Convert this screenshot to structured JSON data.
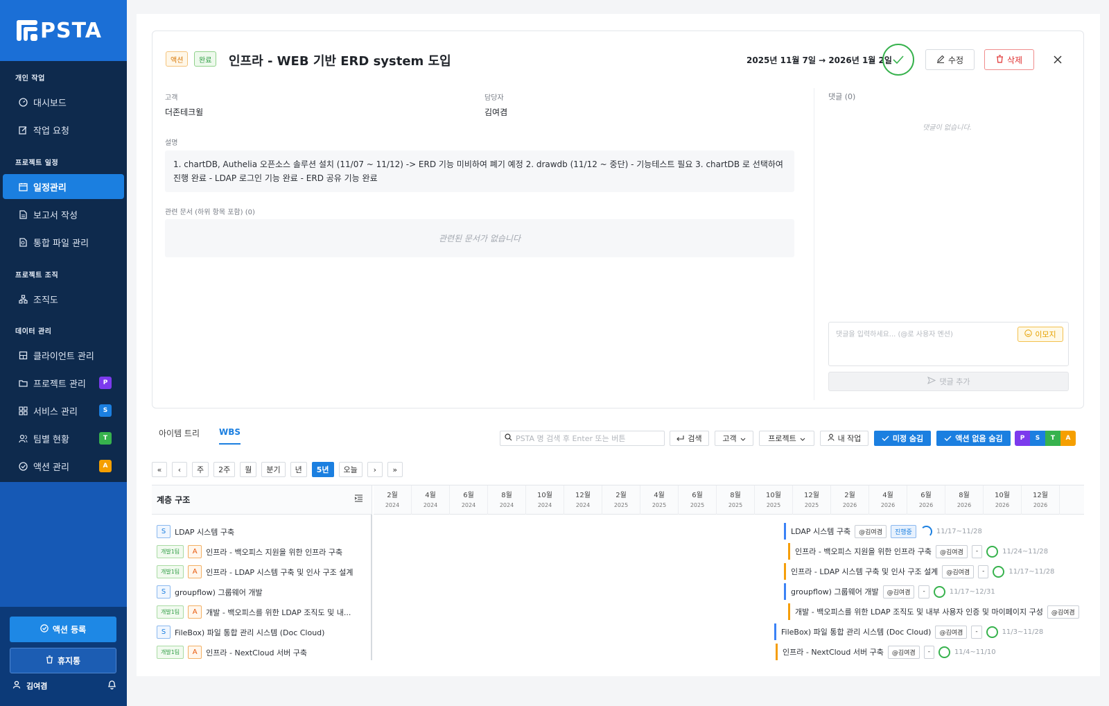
{
  "brand": {
    "logo_text": "PSTA"
  },
  "sidebar": {
    "sections": [
      {
        "label": "개인 작업"
      },
      {
        "label": "프로젝트 일정"
      },
      {
        "label": "프로젝트 조직"
      },
      {
        "label": "데이터 관리"
      }
    ],
    "items": [
      {
        "label": "대시보드",
        "icon": "dashboard-icon"
      },
      {
        "label": "작업 요청",
        "icon": "edit-icon"
      },
      {
        "label": "일정관리",
        "icon": "calendar-icon",
        "active": true
      },
      {
        "label": "보고서 작성",
        "icon": "document-icon"
      },
      {
        "label": "통합 파일 관리",
        "icon": "file-search-icon"
      },
      {
        "label": "조직도",
        "icon": "org-chart-icon"
      },
      {
        "label": "클라이언트 관리",
        "icon": "building-icon"
      },
      {
        "label": "프로젝트 관리",
        "icon": "folder-icon",
        "badge": "P",
        "badge_color": "#7c3aed"
      },
      {
        "label": "서비스 관리",
        "icon": "grid-icon",
        "badge": "S",
        "badge_color": "#1b7fe0"
      },
      {
        "label": "팀별 현황",
        "icon": "team-icon",
        "badge": "T",
        "badge_color": "#37b24d"
      },
      {
        "label": "액션 관리",
        "icon": "check-circle-icon",
        "badge": "A",
        "badge_color": "#f59f00"
      }
    ],
    "register_label": "액션 등록",
    "trash_label": "휴지통",
    "user_name": "김여겸"
  },
  "detail": {
    "tag_action": "액션",
    "tag_done": "완료",
    "title": "인프라 - WEB 기반 ERD system 도입",
    "date_range": "2025년 11월 7일 → 2026년 1월 2일",
    "edit_label": "수정",
    "delete_label": "삭제",
    "customer_label": "고객",
    "customer_value": "더존테크윌",
    "assignee_label": "담당자",
    "assignee_value": "김여겸",
    "description_label": "설명",
    "description": "1. chartDB, Authelia 오픈소스 솔루션 설치 (11/07 ~ 11/12) -> ERD 기능 미비하여 폐기 예정 2. drawdb (11/12 ~ 중단) - 기능테스트 필요 3. chartDB 로 선택하여 진행 완료 - LDAP 로그인 기능 완료 - ERD 공유 기능 완료",
    "docs_label": "관련 문서 (하위 항목 포함) (0)",
    "docs_empty": "관련된 문서가 없습니다",
    "comments_label": "댓글 (0)",
    "comments_empty": "댓글이 없습니다.",
    "comment_placeholder": "댓글을 입력하세요... (@로 사용자 멘션)",
    "emoji_label": "이모지",
    "add_comment_label": "댓글 추가"
  },
  "lower": {
    "tabs": [
      {
        "label": "아이템 트리"
      },
      {
        "label": "WBS",
        "active": true
      }
    ],
    "search_placeholder": "PSTA 명 검색 후 Enter 또는 버튼",
    "search_label": "검색",
    "customer_filter": "고객",
    "project_filter": "프로젝트",
    "my_work_label": "내 작업",
    "hide_undecided_label": "미정 숨김",
    "hide_no_action_label": "액션 없음 숨김",
    "psta_badges": [
      {
        "letter": "P",
        "color": "#7c3aed"
      },
      {
        "letter": "S",
        "color": "#1b7fe0"
      },
      {
        "letter": "T",
        "color": "#37b24d"
      },
      {
        "letter": "A",
        "color": "#f59f00"
      }
    ],
    "zoom": [
      "«",
      "‹",
      "주",
      "2주",
      "월",
      "분기",
      "년",
      "5년",
      "오늘",
      "›",
      "»"
    ],
    "zoom_active": "5년",
    "tree_title": "계층 구조",
    "months": [
      {
        "m": "2월",
        "y": "2024"
      },
      {
        "m": "4월",
        "y": "2024"
      },
      {
        "m": "6월",
        "y": "2024"
      },
      {
        "m": "8월",
        "y": "2024"
      },
      {
        "m": "10월",
        "y": "2024"
      },
      {
        "m": "12월",
        "y": "2024"
      },
      {
        "m": "2월",
        "y": "2025"
      },
      {
        "m": "4월",
        "y": "2025"
      },
      {
        "m": "6월",
        "y": "2025"
      },
      {
        "m": "8월",
        "y": "2025"
      },
      {
        "m": "10월",
        "y": "2025"
      },
      {
        "m": "12월",
        "y": "2025"
      },
      {
        "m": "2월",
        "y": "2026"
      },
      {
        "m": "4월",
        "y": "2026"
      },
      {
        "m": "6월",
        "y": "2026"
      },
      {
        "m": "8월",
        "y": "2026"
      },
      {
        "m": "10월",
        "y": "2026"
      },
      {
        "m": "12월",
        "y": "2026"
      }
    ],
    "rows": [
      {
        "type": "S",
        "label": "LDAP 시스템 구축",
        "bar_label": "LDAP 시스템 구축",
        "user": "@김여겸",
        "status": "진행중",
        "range": "11/17~11/28"
      },
      {
        "type": "A",
        "team": "개발1팀",
        "label": "인프라 - 백오피스 지원을 위한 인프라 구축",
        "bar_label": "인프라 - 백오피스 지원을 위한 인프라 구축",
        "user": "@김여겸",
        "status": "-",
        "range": "11/24~11/28"
      },
      {
        "type": "A",
        "team": "개발1팀",
        "label": "인프라 - LDAP 시스템 구축 및 인사 구조 설계",
        "bar_label": "인프라 - LDAP 시스템 구축 및 인사 구조 설계",
        "user": "@김여겸",
        "status": "-",
        "range": "11/17~11/28"
      },
      {
        "type": "S",
        "label": "groupflow) 그룹웨어 개발",
        "bar_label": "groupflow) 그룹웨어 개발",
        "user": "@김여겸",
        "status": "-",
        "range": "11/17~12/31"
      },
      {
        "type": "A",
        "team": "개발1팀",
        "label": "개발 - 백오피스를 위한 LDAP 조직도 및 내...",
        "bar_label": "개발 - 백오피스를 위한 LDAP 조직도 및 내부 사용자 인증 및 마이페이지 구성",
        "user": "@김여겸"
      },
      {
        "type": "S",
        "label": "FileBox) 파일 통합 관리 시스템 (Doc Cloud)",
        "bar_label": "FileBox) 파일 통합 관리 시스템 (Doc Cloud)",
        "user": "@김여겸",
        "status": "-",
        "range": "11/3~11/28"
      },
      {
        "type": "A",
        "team": "개발1팀",
        "label": "인프라 - NextCloud 서버 구축",
        "bar_label": "인프라 - NextCloud 서버 구축",
        "user": "@김여겸",
        "status": "-",
        "range": "11/4~11/10"
      }
    ]
  }
}
